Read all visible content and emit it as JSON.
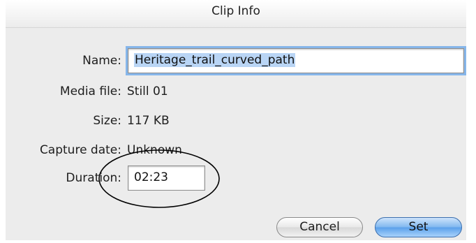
{
  "dialog": {
    "title": "Clip Info"
  },
  "fields": {
    "name_label": "Name:",
    "name_value": "Heritage_trail_curved_path",
    "media_file_label": "Media file:",
    "media_file_value": "Still 01",
    "size_label": "Size:",
    "size_value": "117 KB",
    "capture_date_label": "Capture date:",
    "capture_date_value": "Unknown",
    "duration_label": "Duration:",
    "duration_value": "02:23"
  },
  "buttons": {
    "cancel": "Cancel",
    "set": "Set"
  },
  "colors": {
    "dialog_background": "#ececec",
    "focus_ring": "#86b6ea",
    "selection": "#b9d5f5",
    "default_button": "#5aa0ea"
  }
}
